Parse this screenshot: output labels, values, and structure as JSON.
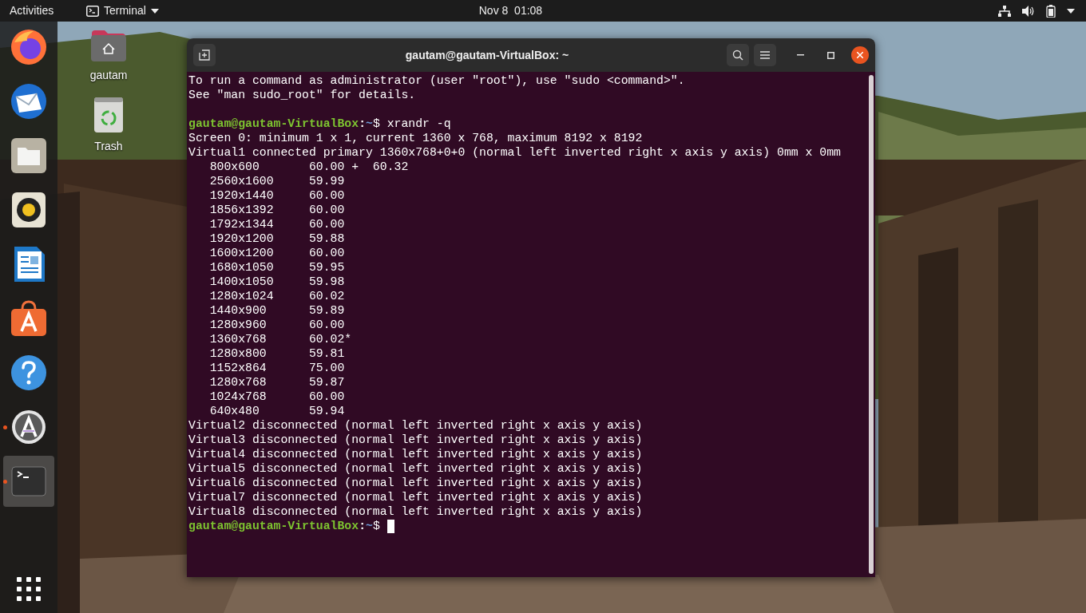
{
  "top_bar": {
    "activities": "Activities",
    "app_menu": "Terminal",
    "clock": "Nov 8  01:08"
  },
  "dock": {
    "apps": [
      {
        "running": false,
        "selected": false
      },
      {
        "running": false,
        "selected": false
      },
      {
        "running": false,
        "selected": false
      },
      {
        "running": false,
        "selected": false
      },
      {
        "running": false,
        "selected": false
      },
      {
        "running": false,
        "selected": false
      },
      {
        "running": false,
        "selected": false
      },
      {
        "running": true,
        "selected": false
      },
      {
        "running": true,
        "selected": true
      }
    ]
  },
  "desktop_icons": [
    {
      "kind": "home",
      "label": "gautam"
    },
    {
      "kind": "trash",
      "label": "Trash"
    }
  ],
  "window": {
    "title": "gautam@gautam-VirtualBox: ~",
    "lines": [
      {
        "kind": "text",
        "text": "To run a command as administrator (user \"root\"), use \"sudo <command>\"."
      },
      {
        "kind": "text",
        "text": "See \"man sudo_root\" for details."
      },
      {
        "kind": "blank"
      },
      {
        "kind": "prompt",
        "user_host": "gautam@gautam-VirtualBox",
        "separator": ":",
        "path": "~",
        "symbol": "$",
        "command": "xrandr -q",
        "cursor": false
      },
      {
        "kind": "text",
        "text": "Screen 0: minimum 1 x 1, current 1360 x 768, maximum 8192 x 8192"
      },
      {
        "kind": "text",
        "text": "Virtual1 connected primary 1360x768+0+0 (normal left inverted right x axis y axis) 0mm x 0mm"
      },
      {
        "kind": "text",
        "text": "   800x600       60.00 +  60.32"
      },
      {
        "kind": "text",
        "text": "   2560x1600     59.99"
      },
      {
        "kind": "text",
        "text": "   1920x1440     60.00"
      },
      {
        "kind": "text",
        "text": "   1856x1392     60.00"
      },
      {
        "kind": "text",
        "text": "   1792x1344     60.00"
      },
      {
        "kind": "text",
        "text": "   1920x1200     59.88"
      },
      {
        "kind": "text",
        "text": "   1600x1200     60.00"
      },
      {
        "kind": "text",
        "text": "   1680x1050     59.95"
      },
      {
        "kind": "text",
        "text": "   1400x1050     59.98"
      },
      {
        "kind": "text",
        "text": "   1280x1024     60.02"
      },
      {
        "kind": "text",
        "text": "   1440x900      59.89"
      },
      {
        "kind": "text",
        "text": "   1280x960      60.00"
      },
      {
        "kind": "text",
        "text": "   1360x768      60.02*"
      },
      {
        "kind": "text",
        "text": "   1280x800      59.81"
      },
      {
        "kind": "text",
        "text": "   1152x864      75.00"
      },
      {
        "kind": "text",
        "text": "   1280x768      59.87"
      },
      {
        "kind": "text",
        "text": "   1024x768      60.00"
      },
      {
        "kind": "text",
        "text": "   640x480       59.94"
      },
      {
        "kind": "text",
        "text": "Virtual2 disconnected (normal left inverted right x axis y axis)"
      },
      {
        "kind": "text",
        "text": "Virtual3 disconnected (normal left inverted right x axis y axis)"
      },
      {
        "kind": "text",
        "text": "Virtual4 disconnected (normal left inverted right x axis y axis)"
      },
      {
        "kind": "text",
        "text": "Virtual5 disconnected (normal left inverted right x axis y axis)"
      },
      {
        "kind": "text",
        "text": "Virtual6 disconnected (normal left inverted right x axis y axis)"
      },
      {
        "kind": "text",
        "text": "Virtual7 disconnected (normal left inverted right x axis y axis)"
      },
      {
        "kind": "text",
        "text": "Virtual8 disconnected (normal left inverted right x axis y axis)"
      },
      {
        "kind": "prompt",
        "user_host": "gautam@gautam-VirtualBox",
        "separator": ":",
        "path": "~",
        "symbol": "$",
        "cursor": true
      }
    ]
  }
}
